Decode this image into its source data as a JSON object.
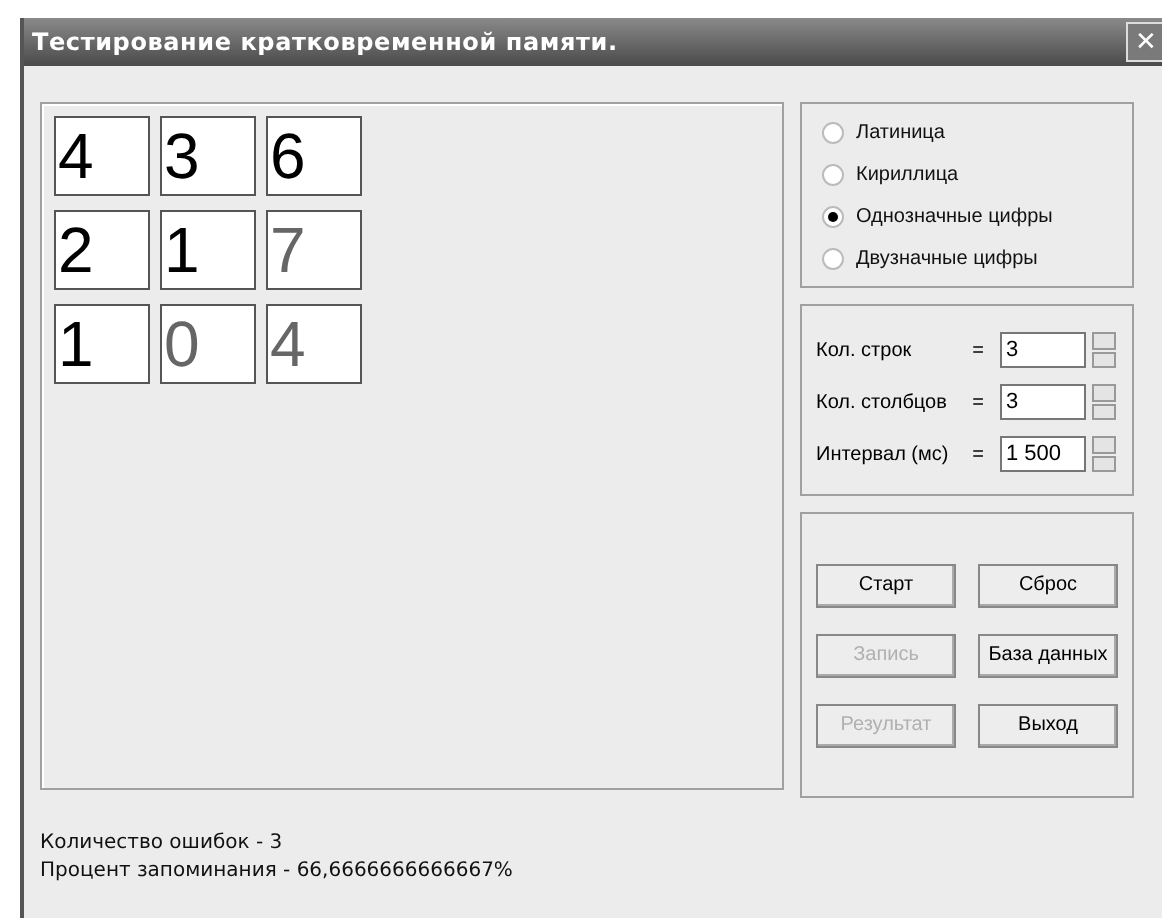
{
  "window": {
    "title": "Тестирование кратковременной памяти.",
    "close": "✕"
  },
  "grid": [
    [
      {
        "digit": "4",
        "error": false
      },
      {
        "digit": "3",
        "error": false
      },
      {
        "digit": "6",
        "error": false
      }
    ],
    [
      {
        "digit": "2",
        "error": false
      },
      {
        "digit": "1",
        "error": false
      },
      {
        "digit": "7",
        "error": true
      }
    ],
    [
      {
        "digit": "1",
        "error": false
      },
      {
        "digit": "0",
        "error": true
      },
      {
        "digit": "4",
        "error": true
      }
    ]
  ],
  "modes": [
    {
      "label": "Латиница",
      "selected": false
    },
    {
      "label": "Кириллица",
      "selected": false
    },
    {
      "label": "Однозначные цифры",
      "selected": true
    },
    {
      "label": "Двузначные цифры",
      "selected": false
    }
  ],
  "settings": [
    {
      "label": "Кол. строк",
      "eq": "=",
      "value": "3"
    },
    {
      "label": "Кол. столбцов",
      "eq": "=",
      "value": "3"
    },
    {
      "label": "Интервал (мс)",
      "eq": "=",
      "value": "1 500"
    }
  ],
  "buttons": [
    {
      "label": "Старт",
      "disabled": false
    },
    {
      "label": "Сброс",
      "disabled": false
    },
    {
      "label": "Запись",
      "disabled": true
    },
    {
      "label": "База данных",
      "disabled": false
    },
    {
      "label": "Результат",
      "disabled": true
    },
    {
      "label": "Выход",
      "disabled": false
    }
  ],
  "status": [
    "Количество ошибок - 3",
    "Процент запоминания - 66,6666666666667%"
  ]
}
